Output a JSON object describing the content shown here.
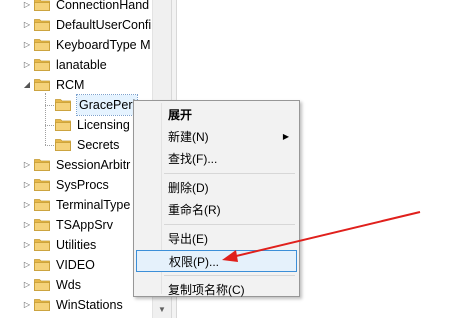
{
  "tree": {
    "items": [
      {
        "label": "ConnectionHand",
        "expandable": true
      },
      {
        "label": "DefaultUserConfi",
        "expandable": true
      },
      {
        "label": "KeyboardType M",
        "expandable": true
      },
      {
        "label": "lanatable",
        "expandable": true
      },
      {
        "label": "RCM",
        "expandable": true,
        "expanded": true
      },
      {
        "label": "GracePeri",
        "expandable": false,
        "selected": true
      },
      {
        "label": "Licensing",
        "expandable": false
      },
      {
        "label": "Secrets",
        "expandable": false
      },
      {
        "label": "SessionArbitr",
        "expandable": true
      },
      {
        "label": "SysProcs",
        "expandable": true
      },
      {
        "label": "TerminalType",
        "expandable": true
      },
      {
        "label": "TSAppSrv",
        "expandable": true
      },
      {
        "label": "Utilities",
        "expandable": true
      },
      {
        "label": "VIDEO",
        "expandable": true
      },
      {
        "label": "Wds",
        "expandable": true
      },
      {
        "label": "WinStations",
        "expandable": true
      }
    ]
  },
  "context_menu": {
    "items": [
      {
        "label": "展开",
        "type": "header"
      },
      {
        "label": "新建(N)",
        "type": "submenu"
      },
      {
        "label": "查找(F)...",
        "type": "item"
      },
      {
        "type": "separator"
      },
      {
        "label": "删除(D)",
        "type": "item"
      },
      {
        "label": "重命名(R)",
        "type": "item"
      },
      {
        "type": "separator"
      },
      {
        "label": "导出(E)",
        "type": "item"
      },
      {
        "label": "权限(P)...",
        "type": "item",
        "highlighted": true
      },
      {
        "type": "separator"
      },
      {
        "label": "复制项名称(C)",
        "type": "item"
      }
    ]
  },
  "icons": {
    "folder": "folder-icon",
    "expand": "expand-triangle-icon",
    "collapse": "collapse-triangle-icon",
    "submenu": "submenu-arrow-icon",
    "scroll_down": "scroll-down-arrow-icon",
    "annotation": "red-arrow-icon"
  },
  "colors": {
    "folder": "#e8b84a",
    "selection": "#e5f3ff",
    "menu_highlight_border": "#3c8fd8",
    "annotation_arrow": "#e0201c"
  }
}
